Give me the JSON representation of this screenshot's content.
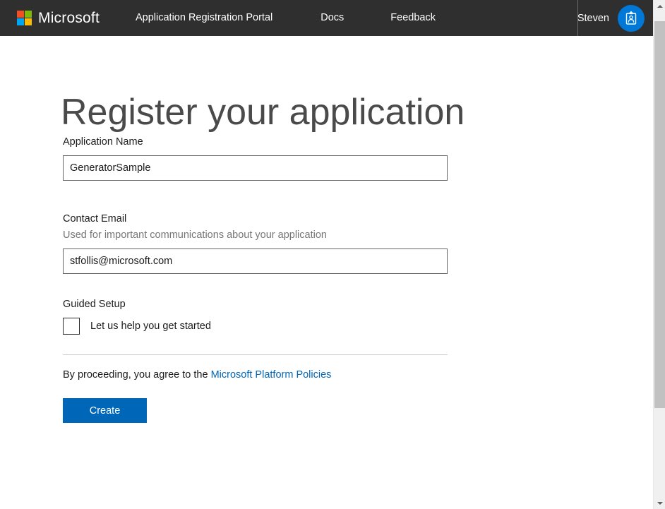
{
  "topbar": {
    "brand": "Microsoft",
    "brand_icon": "microsoft-logo-icon",
    "logo_colors": {
      "top_left": "#f25022",
      "top_right": "#7fba00",
      "bottom_left": "#00a4ef",
      "bottom_right": "#ffb900"
    },
    "background": "#2f2f2f",
    "nav": [
      {
        "label": "Application Registration Portal"
      },
      {
        "label": "Docs"
      },
      {
        "label": "Feedback"
      }
    ],
    "user": {
      "name": "Steven",
      "avatar_icon": "user-badge-icon",
      "avatar_color": "#0078d7"
    }
  },
  "page": {
    "title": "Register your application"
  },
  "form": {
    "app_name": {
      "label": "Application Name",
      "value": "GeneratorSample",
      "placeholder": ""
    },
    "contact_email": {
      "label": "Contact Email",
      "hint": "Used for important communications about your application",
      "value": "stfollis@microsoft.com",
      "placeholder": ""
    },
    "guided_setup": {
      "label": "Guided Setup",
      "checkbox_label": "Let us help you get started",
      "checked": false
    },
    "terms": {
      "text_before": "By proceeding, you agree to the ",
      "link_label": "Microsoft Platform Policies",
      "link_color": "#0067b8"
    },
    "create_button": {
      "label": "Create",
      "color": "#0067b8"
    }
  },
  "scrollbar": {
    "up_arrow_icon": "triangle-up-icon",
    "down_arrow_icon": "triangle-down-icon",
    "thumb_color": "#c1c1c1",
    "track_color": "#f0f0f0"
  }
}
